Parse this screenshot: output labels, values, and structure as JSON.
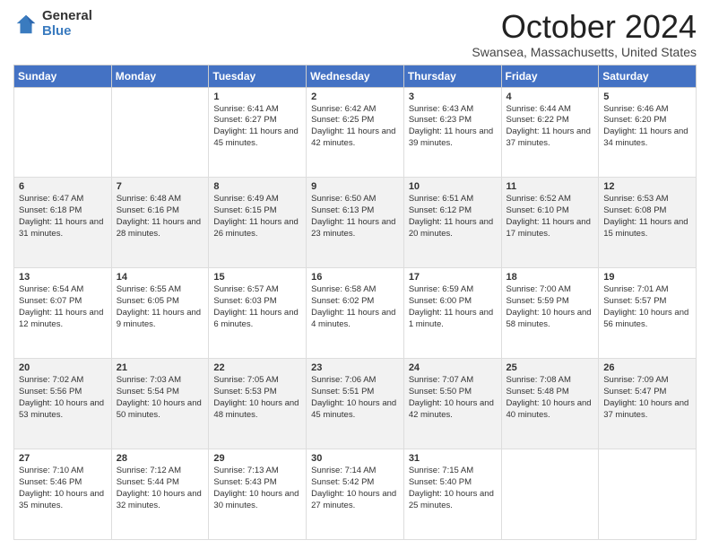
{
  "header": {
    "logo_general": "General",
    "logo_blue": "Blue",
    "month_title": "October 2024",
    "location": "Swansea, Massachusetts, United States"
  },
  "days_of_week": [
    "Sunday",
    "Monday",
    "Tuesday",
    "Wednesday",
    "Thursday",
    "Friday",
    "Saturday"
  ],
  "weeks": [
    [
      {
        "day": "",
        "info": ""
      },
      {
        "day": "",
        "info": ""
      },
      {
        "day": "1",
        "info": "Sunrise: 6:41 AM\nSunset: 6:27 PM\nDaylight: 11 hours and 45 minutes."
      },
      {
        "day": "2",
        "info": "Sunrise: 6:42 AM\nSunset: 6:25 PM\nDaylight: 11 hours and 42 minutes."
      },
      {
        "day": "3",
        "info": "Sunrise: 6:43 AM\nSunset: 6:23 PM\nDaylight: 11 hours and 39 minutes."
      },
      {
        "day": "4",
        "info": "Sunrise: 6:44 AM\nSunset: 6:22 PM\nDaylight: 11 hours and 37 minutes."
      },
      {
        "day": "5",
        "info": "Sunrise: 6:46 AM\nSunset: 6:20 PM\nDaylight: 11 hours and 34 minutes."
      }
    ],
    [
      {
        "day": "6",
        "info": "Sunrise: 6:47 AM\nSunset: 6:18 PM\nDaylight: 11 hours and 31 minutes."
      },
      {
        "day": "7",
        "info": "Sunrise: 6:48 AM\nSunset: 6:16 PM\nDaylight: 11 hours and 28 minutes."
      },
      {
        "day": "8",
        "info": "Sunrise: 6:49 AM\nSunset: 6:15 PM\nDaylight: 11 hours and 26 minutes."
      },
      {
        "day": "9",
        "info": "Sunrise: 6:50 AM\nSunset: 6:13 PM\nDaylight: 11 hours and 23 minutes."
      },
      {
        "day": "10",
        "info": "Sunrise: 6:51 AM\nSunset: 6:12 PM\nDaylight: 11 hours and 20 minutes."
      },
      {
        "day": "11",
        "info": "Sunrise: 6:52 AM\nSunset: 6:10 PM\nDaylight: 11 hours and 17 minutes."
      },
      {
        "day": "12",
        "info": "Sunrise: 6:53 AM\nSunset: 6:08 PM\nDaylight: 11 hours and 15 minutes."
      }
    ],
    [
      {
        "day": "13",
        "info": "Sunrise: 6:54 AM\nSunset: 6:07 PM\nDaylight: 11 hours and 12 minutes."
      },
      {
        "day": "14",
        "info": "Sunrise: 6:55 AM\nSunset: 6:05 PM\nDaylight: 11 hours and 9 minutes."
      },
      {
        "day": "15",
        "info": "Sunrise: 6:57 AM\nSunset: 6:03 PM\nDaylight: 11 hours and 6 minutes."
      },
      {
        "day": "16",
        "info": "Sunrise: 6:58 AM\nSunset: 6:02 PM\nDaylight: 11 hours and 4 minutes."
      },
      {
        "day": "17",
        "info": "Sunrise: 6:59 AM\nSunset: 6:00 PM\nDaylight: 11 hours and 1 minute."
      },
      {
        "day": "18",
        "info": "Sunrise: 7:00 AM\nSunset: 5:59 PM\nDaylight: 10 hours and 58 minutes."
      },
      {
        "day": "19",
        "info": "Sunrise: 7:01 AM\nSunset: 5:57 PM\nDaylight: 10 hours and 56 minutes."
      }
    ],
    [
      {
        "day": "20",
        "info": "Sunrise: 7:02 AM\nSunset: 5:56 PM\nDaylight: 10 hours and 53 minutes."
      },
      {
        "day": "21",
        "info": "Sunrise: 7:03 AM\nSunset: 5:54 PM\nDaylight: 10 hours and 50 minutes."
      },
      {
        "day": "22",
        "info": "Sunrise: 7:05 AM\nSunset: 5:53 PM\nDaylight: 10 hours and 48 minutes."
      },
      {
        "day": "23",
        "info": "Sunrise: 7:06 AM\nSunset: 5:51 PM\nDaylight: 10 hours and 45 minutes."
      },
      {
        "day": "24",
        "info": "Sunrise: 7:07 AM\nSunset: 5:50 PM\nDaylight: 10 hours and 42 minutes."
      },
      {
        "day": "25",
        "info": "Sunrise: 7:08 AM\nSunset: 5:48 PM\nDaylight: 10 hours and 40 minutes."
      },
      {
        "day": "26",
        "info": "Sunrise: 7:09 AM\nSunset: 5:47 PM\nDaylight: 10 hours and 37 minutes."
      }
    ],
    [
      {
        "day": "27",
        "info": "Sunrise: 7:10 AM\nSunset: 5:46 PM\nDaylight: 10 hours and 35 minutes."
      },
      {
        "day": "28",
        "info": "Sunrise: 7:12 AM\nSunset: 5:44 PM\nDaylight: 10 hours and 32 minutes."
      },
      {
        "day": "29",
        "info": "Sunrise: 7:13 AM\nSunset: 5:43 PM\nDaylight: 10 hours and 30 minutes."
      },
      {
        "day": "30",
        "info": "Sunrise: 7:14 AM\nSunset: 5:42 PM\nDaylight: 10 hours and 27 minutes."
      },
      {
        "day": "31",
        "info": "Sunrise: 7:15 AM\nSunset: 5:40 PM\nDaylight: 10 hours and 25 minutes."
      },
      {
        "day": "",
        "info": ""
      },
      {
        "day": "",
        "info": ""
      }
    ]
  ]
}
